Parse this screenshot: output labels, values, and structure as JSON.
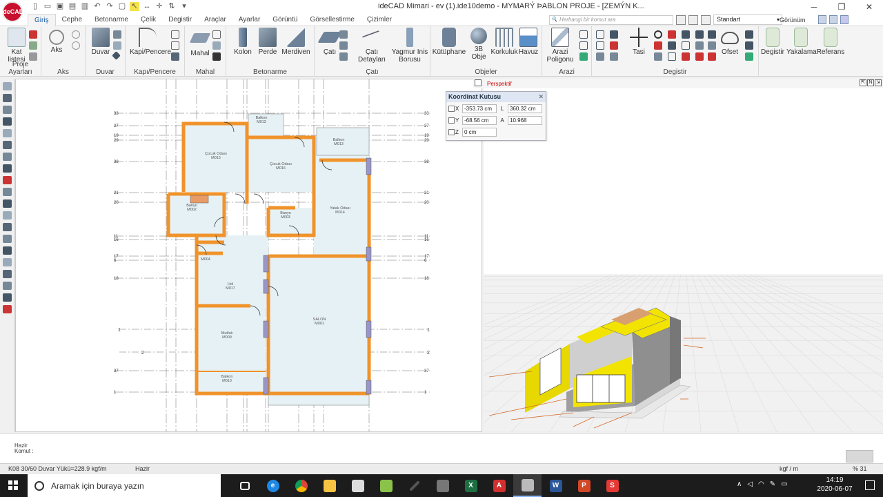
{
  "app": {
    "logo_text": "ideCAD",
    "title": "ideCAD Mimari - ev (1).ide10demo - MYMARÝ ÞABLON PROJE - [ZEMÝN K..."
  },
  "tabs": [
    "Giriş",
    "Cephe",
    "Betonarme",
    "Çelik",
    "Degistir",
    "Araçlar",
    "Ayarlar",
    "Görüntü",
    "Görsellestirme",
    "Çizimler"
  ],
  "active_tab": "Giriş",
  "command_search": {
    "placeholder": "Herhangi bir komut ara"
  },
  "style_combo": {
    "value": "Standart"
  },
  "view_menu": "Görünüm",
  "ribbon": {
    "groups": [
      {
        "label": "Proje Ayarları",
        "buttons": [
          "Kat listesi"
        ]
      },
      {
        "label": "Aks",
        "buttons": [
          "Aks"
        ]
      },
      {
        "label": "Duvar",
        "buttons": [
          "Duvar"
        ]
      },
      {
        "label": "Kapı/Pencere",
        "buttons": [
          "Kapi/Pencere"
        ]
      },
      {
        "label": "Mahal",
        "buttons": [
          "Mahal"
        ]
      },
      {
        "label": "Betonarme",
        "buttons": [
          "Kolon",
          "Perde",
          "Merdiven"
        ]
      },
      {
        "label": "Çatı",
        "buttons": [
          "Çatı",
          "Çatı Detayları",
          "Yagmur Inis Borusu"
        ]
      },
      {
        "label": "Objeler",
        "buttons": [
          "Kütüphane",
          "3B Obje",
          "Korkuluk",
          "Havuz"
        ]
      },
      {
        "label": "Arazi",
        "buttons": [
          "Arazi Poligonu"
        ]
      },
      {
        "label": "Degistir",
        "buttons": [
          "Tasi",
          "Ofset",
          "Degistir",
          "Yakalama",
          "Referans"
        ]
      }
    ]
  },
  "viewport_3d": {
    "label": "Perspektif"
  },
  "coordinate_box": {
    "title": "Koordinat Kutusu",
    "x": "-353.73 cm",
    "y": "-68.56 cm",
    "z": "0 cm",
    "l": "360.32 cm",
    "a": "10.968"
  },
  "plan": {
    "rooms": [
      {
        "name": "Balkon",
        "code": "M012"
      },
      {
        "name": "Çocuk Odası",
        "code": "M015"
      },
      {
        "name": "Çocuk Odası",
        "code": "M016"
      },
      {
        "name": "Balkon",
        "code": "M013"
      },
      {
        "name": "Banyo",
        "code": "M002"
      },
      {
        "name": "Banyo",
        "code": "M003"
      },
      {
        "name": "Yatak Odası",
        "code": "M014"
      },
      {
        "name": "Hol",
        "code": "M017"
      },
      {
        "name": "SALON",
        "code": "M001"
      },
      {
        "name": "Mutfak",
        "code": "M009"
      },
      {
        "name": "Balkon",
        "code": "M010"
      },
      {
        "name": "M004",
        "code": ""
      }
    ],
    "axis_labels_left": [
      "33",
      "27",
      "19",
      "29",
      "38",
      "21",
      "20",
      "11",
      "16",
      "17",
      "6",
      "18",
      "37",
      "1"
    ],
    "axis_labels_right": [
      "33",
      "27",
      "19",
      "29",
      "38",
      "21",
      "20",
      "11",
      "16",
      "17",
      "6",
      "18",
      "37",
      "1"
    ],
    "grid_marks": [
      "1",
      "2"
    ]
  },
  "command": {
    "line1": "Hazir",
    "line2": "Komut :"
  },
  "status": {
    "element": "K08 30/60 Duvar Yükü=228.9 kgf/m",
    "state": "Hazir",
    "unit": "kgf / m",
    "zoom": "% 31"
  },
  "taskbar": {
    "search_placeholder": "Aramak için buraya yazın",
    "time": "14:19",
    "date": "2020-06-07"
  },
  "colors": {
    "wall": "#f0932b",
    "room_fill": "#e6f1f5",
    "accent": "#1b5fa8",
    "building_yellow": "#f2e400"
  }
}
